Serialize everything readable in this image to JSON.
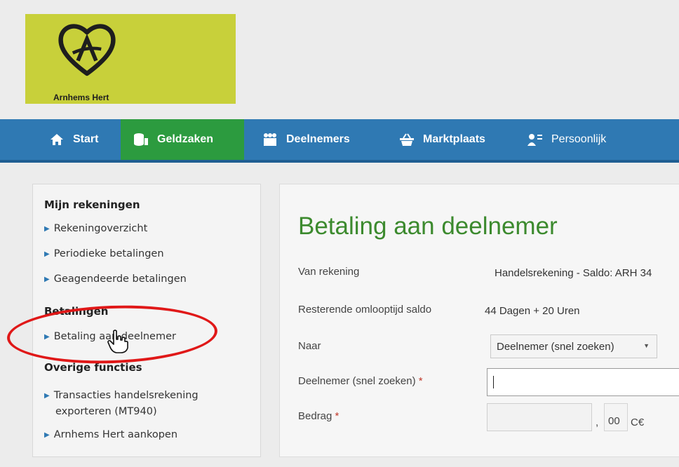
{
  "brand": {
    "logo_text": "Arnhems Hert"
  },
  "nav": {
    "items": [
      {
        "label": "Start",
        "icon": "home-icon"
      },
      {
        "label": "Geldzaken",
        "icon": "coins-icon",
        "active": true
      },
      {
        "label": "Deelnemers",
        "icon": "people-icon"
      },
      {
        "label": "Marktplaats",
        "icon": "basket-icon"
      },
      {
        "label": "Persoonlijk",
        "icon": "user-list-icon"
      }
    ]
  },
  "sidebar": {
    "sections": [
      {
        "heading": "Mijn rekeningen",
        "links": [
          "Rekeningoverzicht",
          "Periodieke betalingen",
          "Geagendeerde betalingen"
        ]
      },
      {
        "heading": "Betalingen",
        "links": [
          "Betaling aan deelnemer"
        ]
      },
      {
        "heading": "Overige functies",
        "links": [
          "Transacties handelsrekening",
          "exporteren (MT940)",
          "Arnhems Hert aankopen"
        ]
      }
    ]
  },
  "main": {
    "title": "Betaling aan deelnemer",
    "fields": {
      "van_rekening": {
        "label": "Van rekening",
        "value": "Handelsrekening - Saldo: ARH 34"
      },
      "resterende": {
        "label": "Resterende omlooptijd saldo",
        "value": "44 Dagen + 20 Uren"
      },
      "naar": {
        "label": "Naar",
        "value": "Deelnemer (snel zoeken)"
      },
      "deelnemer": {
        "label": "Deelnemer (snel zoeken)",
        "required_mark": "*",
        "value": ""
      },
      "bedrag": {
        "label": "Bedrag",
        "required_mark": "*",
        "value": "",
        "comma": ",",
        "cents": "00",
        "currency": "C€"
      }
    }
  },
  "colors": {
    "logo_bg": "#c8d03a",
    "nav_bg": "#2f79b3",
    "nav_active": "#2c9b3f",
    "title_green": "#3c8a2e",
    "highlight_red": "#e01818"
  }
}
